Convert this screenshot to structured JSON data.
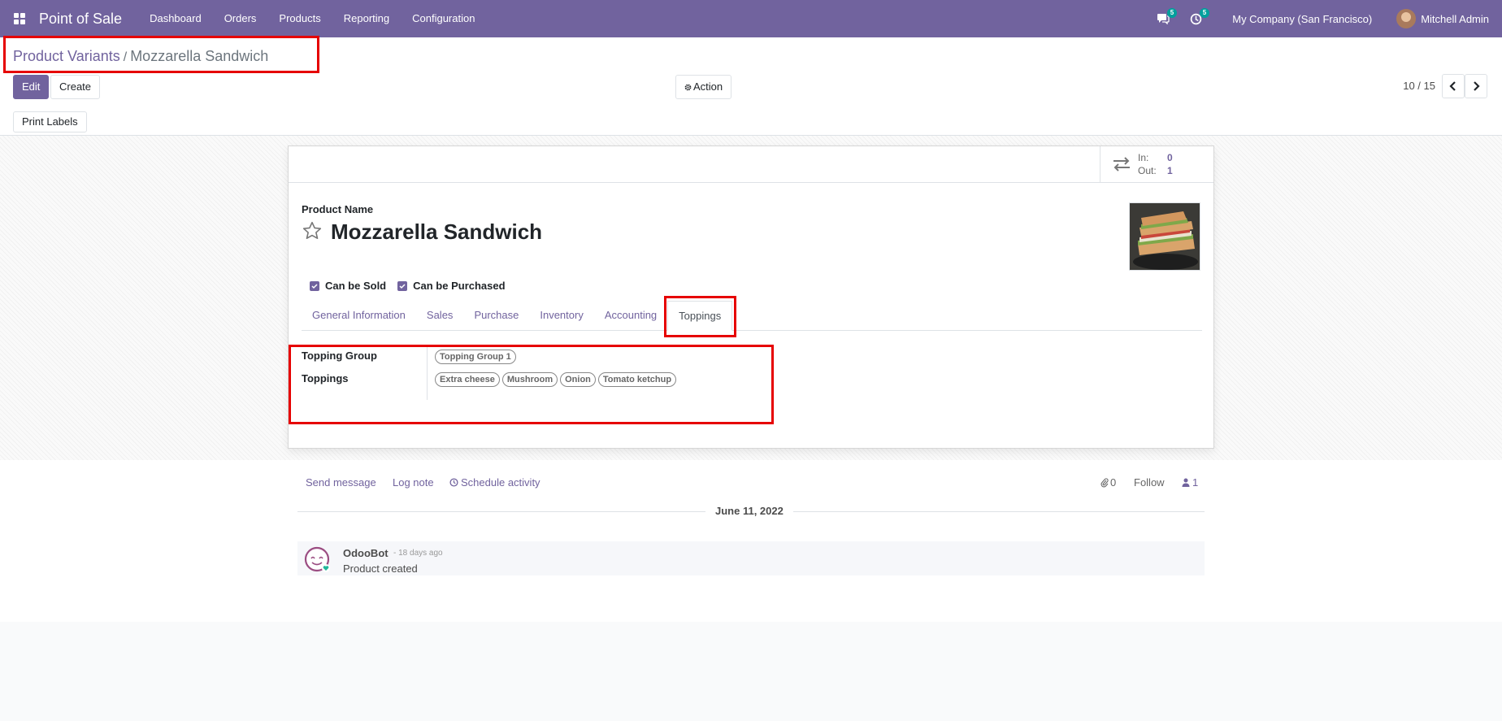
{
  "navbar": {
    "app_name": "Point of Sale",
    "menu": [
      "Dashboard",
      "Orders",
      "Products",
      "Reporting",
      "Configuration"
    ],
    "messages_count": "5",
    "activities_count": "5",
    "company": "My Company (San Francisco)",
    "user": "Mitchell Admin"
  },
  "breadcrumb": {
    "parent": "Product Variants",
    "separator": "/",
    "current": "Mozzarella Sandwich"
  },
  "toolbar": {
    "edit_label": "Edit",
    "create_label": "Create",
    "action_label": "Action",
    "pager": "10 / 15",
    "print_labels": "Print Labels"
  },
  "stats": {
    "in_label": "In:",
    "in_value": "0",
    "out_label": "Out:",
    "out_value": "1"
  },
  "form": {
    "product_name_label": "Product Name",
    "product_name": "Mozzarella Sandwich",
    "can_be_sold": "Can be Sold",
    "can_be_purchased": "Can be Purchased",
    "tabs": [
      "General Information",
      "Sales",
      "Purchase",
      "Inventory",
      "Accounting",
      "Toppings"
    ],
    "active_tab": "Toppings",
    "topping_group_label": "Topping Group",
    "topping_group_tags": [
      "Topping Group 1"
    ],
    "toppings_label": "Toppings",
    "toppings_tags": [
      "Extra cheese",
      "Mushroom",
      "Onion",
      "Tomato ketchup"
    ]
  },
  "chatter": {
    "send_message": "Send message",
    "log_note": "Log note",
    "schedule_activity": "Schedule activity",
    "attachments_count": "0",
    "follow": "Follow",
    "followers_count": "1",
    "date_separator": "June 11, 2022",
    "message": {
      "author": "OdooBot",
      "date": "- 18 days ago",
      "body": "Product created"
    }
  },
  "colors": {
    "brand": "#71639e",
    "highlight": "#e60000",
    "badge": "#00a09d"
  }
}
